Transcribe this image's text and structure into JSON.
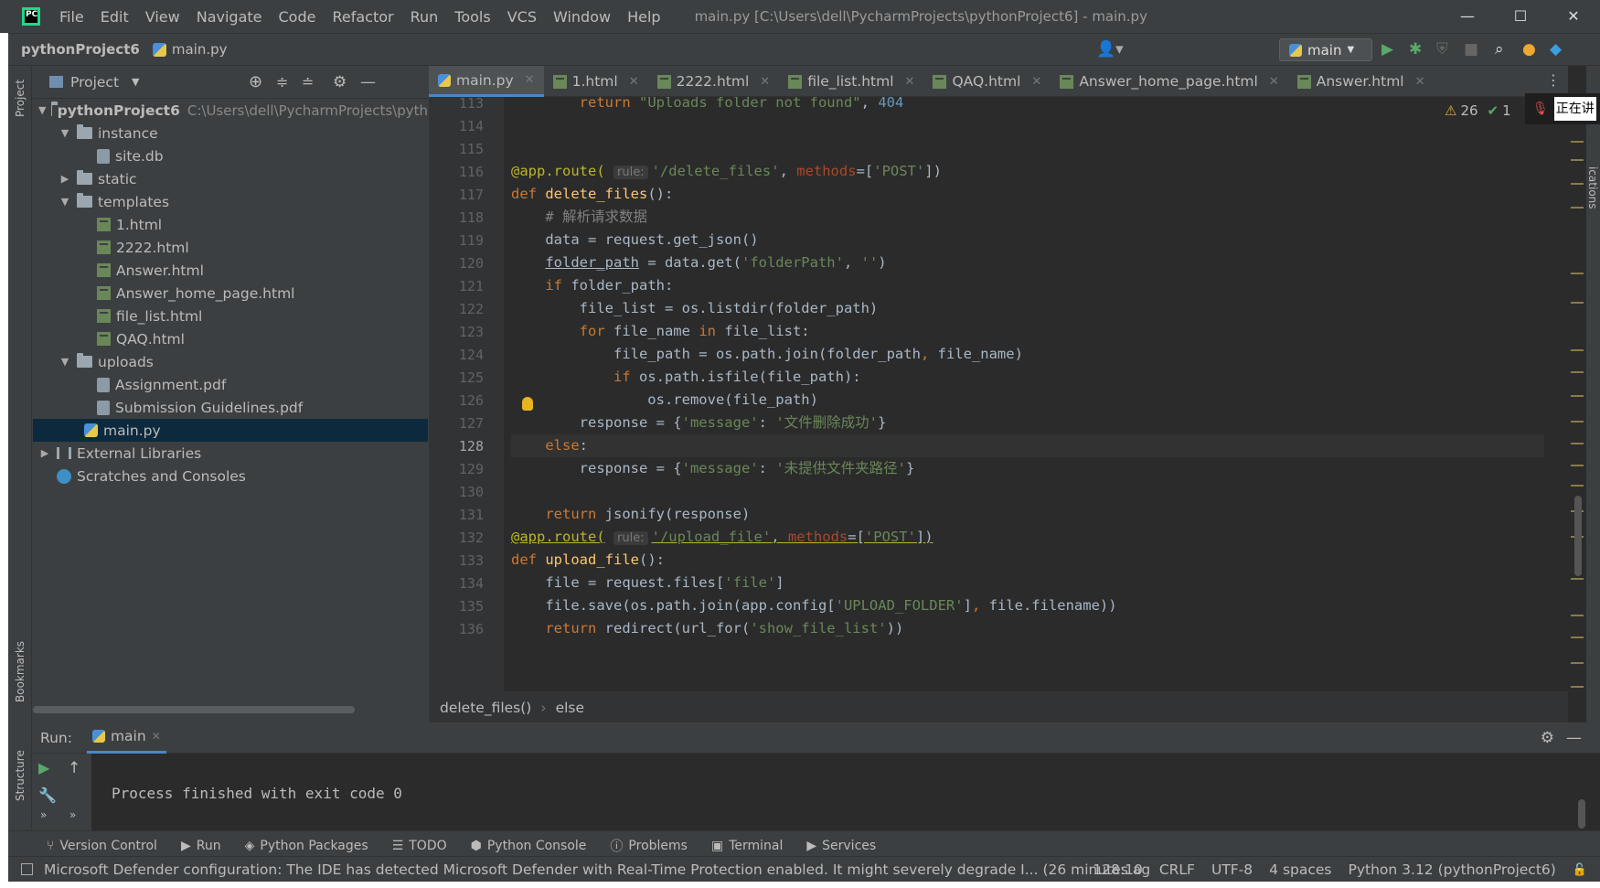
{
  "app": {
    "menu": [
      "File",
      "Edit",
      "View",
      "Navigate",
      "Code",
      "Refactor",
      "Run",
      "Tools",
      "VCS",
      "Window",
      "Help"
    ],
    "window_title": "main.py [C:\\Users\\dell\\PycharmProjects\\pythonProject6] - main.py",
    "win_controls": [
      "—",
      "☐",
      "✕"
    ]
  },
  "navbar": {
    "project": "pythonProject6",
    "file": "main.py",
    "run_config": "main"
  },
  "project_panel": {
    "title": "Project",
    "tree": [
      {
        "label": "pythonProject6",
        "path": "C:\\Users\\dell\\PycharmProjects\\pyth",
        "type": "folder",
        "depth": 0,
        "open": true,
        "bold": true
      },
      {
        "label": "instance",
        "type": "folder",
        "depth": 1,
        "open": true
      },
      {
        "label": "site.db",
        "type": "file",
        "depth": 2
      },
      {
        "label": "static",
        "type": "folder",
        "depth": 1,
        "open": false
      },
      {
        "label": "templates",
        "type": "folder",
        "depth": 1,
        "open": true
      },
      {
        "label": "1.html",
        "type": "html",
        "depth": 2
      },
      {
        "label": "2222.html",
        "type": "html",
        "depth": 2
      },
      {
        "label": "Answer.html",
        "type": "html",
        "depth": 2
      },
      {
        "label": "Answer_home_page.html",
        "type": "html",
        "depth": 2
      },
      {
        "label": "file_list.html",
        "type": "html",
        "depth": 2
      },
      {
        "label": "QAQ.html",
        "type": "html",
        "depth": 2
      },
      {
        "label": "uploads",
        "type": "folder",
        "depth": 1,
        "open": true
      },
      {
        "label": "Assignment.pdf",
        "type": "file",
        "depth": 2
      },
      {
        "label": "Submission Guidelines.pdf",
        "type": "file",
        "depth": 2
      },
      {
        "label": "main.py",
        "type": "py",
        "depth": 1,
        "selected": true
      },
      {
        "label": "External Libraries",
        "type": "lib",
        "depth": 0,
        "open": false
      },
      {
        "label": "Scratches and Consoles",
        "type": "scratch",
        "depth": 0
      }
    ]
  },
  "tabs": [
    "main.py",
    "1.html",
    "2222.html",
    "file_list.html",
    "QAQ.html",
    "Answer_home_page.html",
    "Answer.html"
  ],
  "inspections": {
    "warnings": "26",
    "ok": "1"
  },
  "editor": {
    "line_numbers": [
      "113",
      "114",
      "115",
      "116",
      "117",
      "118",
      "119",
      "120",
      "121",
      "122",
      "123",
      "124",
      "125",
      "126",
      "127",
      "128",
      "129",
      "130",
      "131",
      "132",
      "133",
      "134",
      "135",
      "136"
    ],
    "current_line": "128"
  },
  "breadcrumb": [
    "delete_files()",
    "else"
  ],
  "run": {
    "label": "Run:",
    "tab": "main",
    "output": "Process finished with exit code 0"
  },
  "toolwindows": [
    "Version Control",
    "Run",
    "Python Packages",
    "TODO",
    "Python Console",
    "Problems",
    "Terminal",
    "Services"
  ],
  "side_labels": {
    "project": "Project",
    "bookmarks": "Bookmarks",
    "structure": "Structure",
    "notifications": "ications"
  },
  "status": {
    "message": "Microsoft Defender configuration: The IDE has detected Microsoft Defender with Real-Time Protection enabled. It might severely degrade I... (26 minutes ag",
    "position": "128:10",
    "line_sep": "CRLF",
    "encoding": "UTF-8",
    "indent": "4 spaces",
    "interpreter": "Python 3.12 (pythonProject6)"
  },
  "overlay": {
    "text": "正在讲"
  }
}
